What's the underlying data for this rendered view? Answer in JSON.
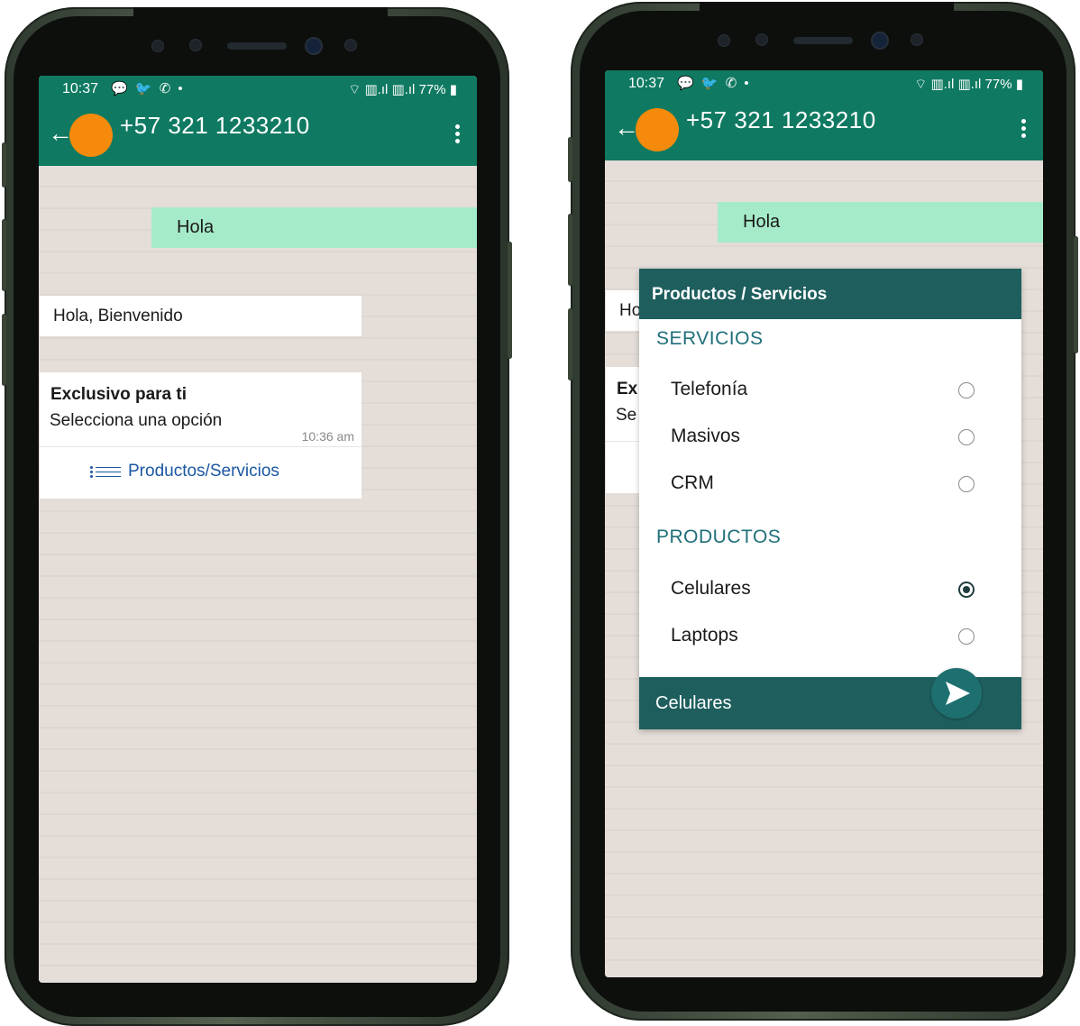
{
  "phones": [
    {
      "status": {
        "time": "10:37",
        "icons": "💬 🐦 ✆ •",
        "signal": "⌔ ▥.ıl ▥.ıl",
        "battery": "77%"
      },
      "header": {
        "contact": "+57 321 1233210"
      },
      "chat": {
        "outgoing": "Hola",
        "welcome": "Hola, Bienvenido",
        "card_title": "Exclusivo para ti",
        "card_body": "Selecciona una opción",
        "card_time": "10:36 am",
        "list_button": "Productos/Servicios"
      }
    },
    {
      "status": {
        "time": "10:37",
        "icons": "💬 🐦 ✆ •",
        "signal": "⌔ ▥.ıl ▥.ıl",
        "battery": "77%"
      },
      "header": {
        "contact": "+57 321 1233210"
      },
      "chat": {
        "outgoing": "Hola",
        "peek_welcome": "Ho",
        "peek_title": "Ex",
        "peek_body": "Se"
      },
      "sheet": {
        "title": "Productos / Servicios",
        "sections": [
          {
            "title": "SERVICIOS",
            "options": [
              {
                "label": "Telefonía",
                "selected": false
              },
              {
                "label": "Masivos",
                "selected": false
              },
              {
                "label": "CRM",
                "selected": false
              }
            ]
          },
          {
            "title": "PRODUCTOS",
            "options": [
              {
                "label": "Celulares",
                "selected": true
              },
              {
                "label": "Laptops",
                "selected": false
              }
            ]
          }
        ],
        "selected_value": "Celulares"
      }
    }
  ],
  "colors": {
    "header": "#0f7a61",
    "outgoing_bubble": "#a6ebc9",
    "sheet_header": "#1e5f5e",
    "avatar": "#f58a0c",
    "link": "#1b57a3"
  }
}
